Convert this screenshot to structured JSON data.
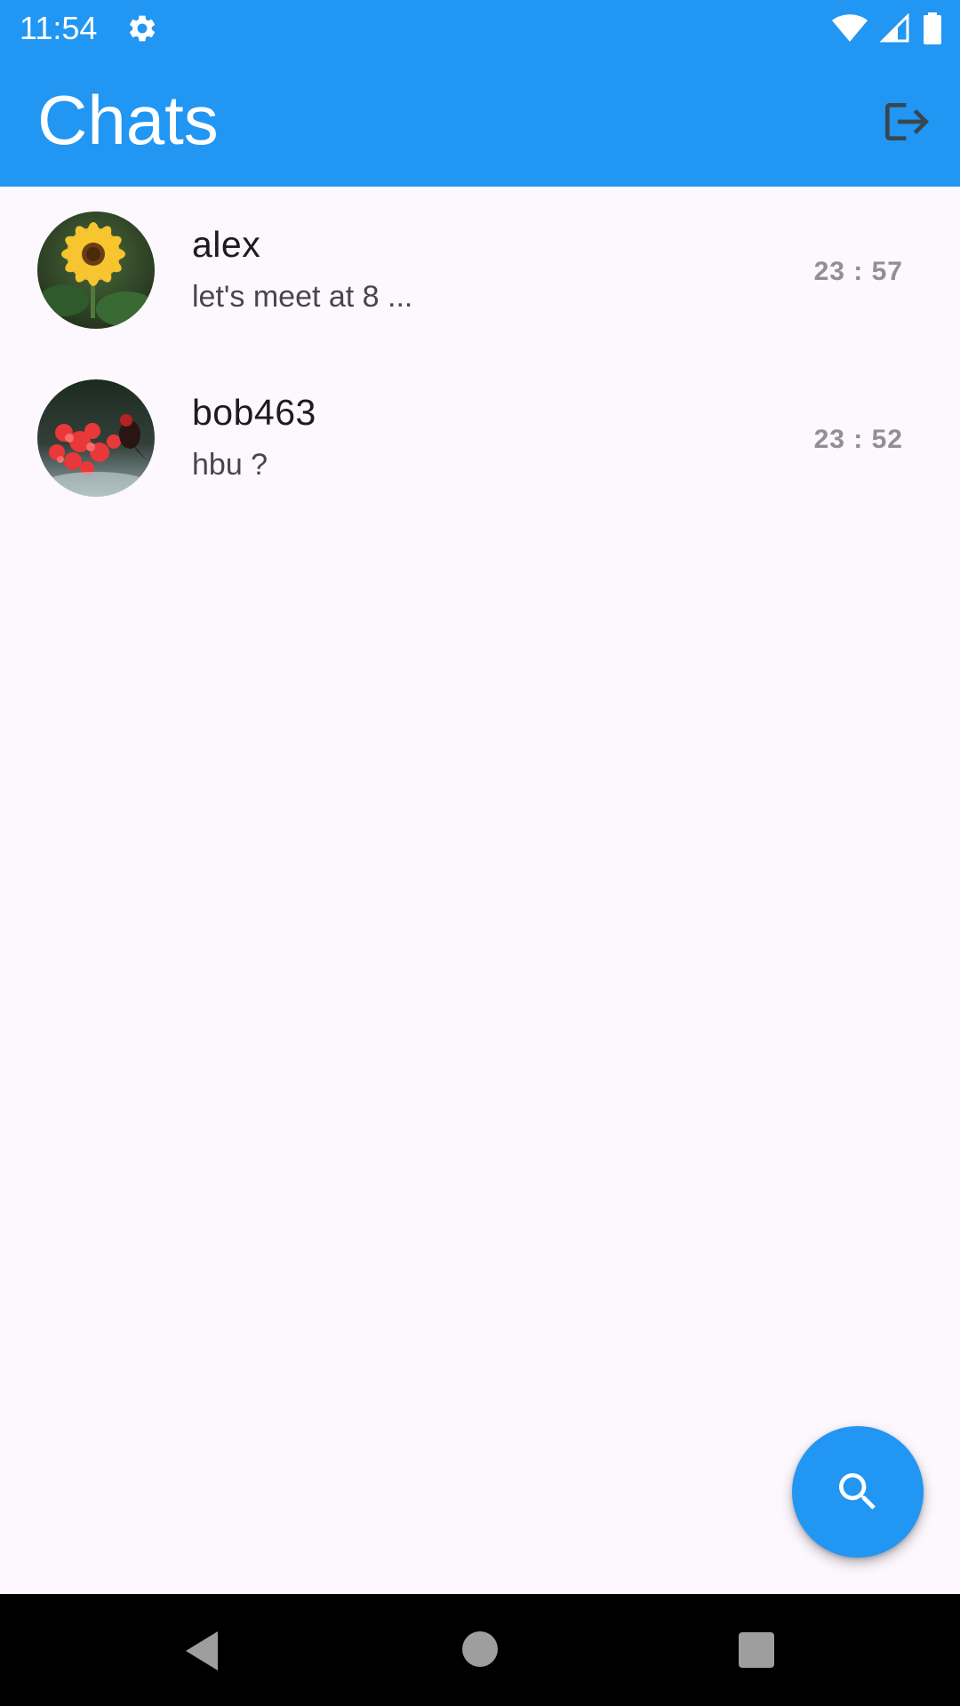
{
  "status_bar": {
    "time": "11:54",
    "icons": [
      "settings-gear-icon",
      "wifi-icon",
      "cell-signal-icon",
      "battery-icon"
    ]
  },
  "app_bar": {
    "title": "Chats",
    "action_icon": "logout-icon"
  },
  "chats": [
    {
      "name": "alex",
      "preview": "let's meet at 8 ...",
      "time": "23 : 57",
      "avatar": "sunflower-photo"
    },
    {
      "name": "bob463",
      "preview": "hbu ?",
      "time": "23 : 52",
      "avatar": "red-flowers-bird-photo"
    }
  ],
  "fab": {
    "icon": "search-icon"
  },
  "nav_bar": {
    "buttons": [
      "back-icon",
      "home-icon",
      "recents-icon"
    ]
  },
  "colors": {
    "primary": "#2196f3",
    "background": "#fdf7fe",
    "nav_bar": "#000000"
  }
}
